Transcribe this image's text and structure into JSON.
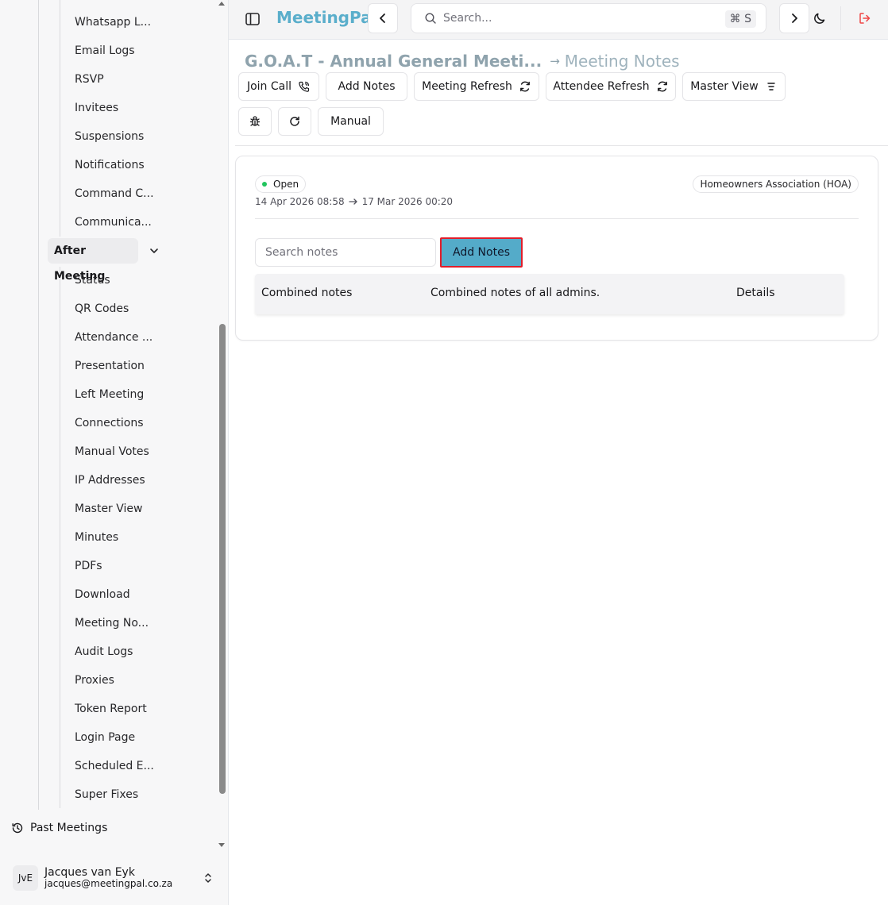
{
  "app": {
    "name": "MeetingPal"
  },
  "header": {
    "search_placeholder": "Search...",
    "search_shortcut": "⌘ S"
  },
  "sidebar": {
    "items": [
      "Whatsapp L...",
      "Email Logs",
      "RSVP",
      "Invitees",
      "Suspensions",
      "Notifications",
      "Command C...",
      "Communica..."
    ],
    "group": {
      "label": "After Meeting"
    },
    "group_items": [
      "Status",
      "QR Codes",
      "Attendance ...",
      "Presentation",
      "Left Meeting",
      "Connections",
      "Manual Votes",
      "IP Addresses",
      "Master View",
      "Minutes",
      "PDFs",
      "Download",
      "Meeting No...",
      "Audit Logs",
      "Proxies",
      "Token Report",
      "Login Page",
      "Scheduled E...",
      "Super Fixes"
    ],
    "past_meetings": "Past Meetings",
    "user": {
      "initials": "JvE",
      "name": "Jacques van Eyk",
      "email": "jacques@meetingpal.co.za"
    }
  },
  "breadcrumb": {
    "meeting": "G.O.A.T - Annual General Meeti...",
    "page": "Meeting Notes"
  },
  "toolbar": {
    "join_call": "Join Call",
    "add_notes": "Add Notes",
    "meeting_refresh": "Meeting Refresh",
    "attendee_refresh": "Attendee Refresh",
    "master_view": "Master View",
    "manual": "Manual"
  },
  "meeting": {
    "status": "Open",
    "start": "14 Apr 2026 08:58",
    "end": "17 Mar 2026 00:20",
    "organization": "Homeowners Association (HOA)"
  },
  "notes": {
    "search_placeholder": "Search notes",
    "add_button": "Add Notes",
    "rows": [
      {
        "title": "Combined notes",
        "description": "Combined notes of all admins.",
        "action": "Details"
      }
    ]
  },
  "colors": {
    "brand": "#5aaecb",
    "accent_button": "#54abc9",
    "highlight_border": "#e11d2a",
    "status_open": "#22c55e",
    "logout": "#ef4444"
  }
}
